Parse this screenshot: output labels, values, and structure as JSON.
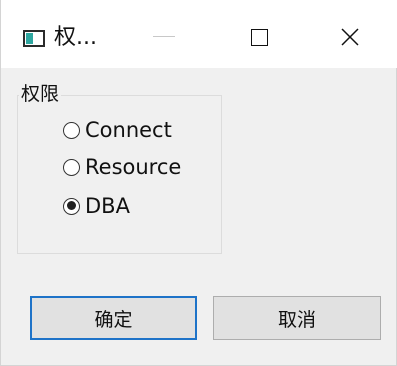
{
  "window": {
    "title": "权...",
    "controls": {
      "minimize_icon": "minimize-icon",
      "maximize_icon": "maximize-icon",
      "close_icon": "close-icon"
    }
  },
  "permissions": {
    "group_label": "权限",
    "options": [
      {
        "label": "Connect",
        "checked": false
      },
      {
        "label": "Resource",
        "checked": false
      },
      {
        "label": "DBA",
        "checked": true
      }
    ]
  },
  "buttons": {
    "ok_label": "确定",
    "cancel_label": "取消"
  },
  "colors": {
    "accent": "#1e73c8",
    "icon_bar": "#2ea7a0",
    "window_bg": "#f0f0f0"
  }
}
